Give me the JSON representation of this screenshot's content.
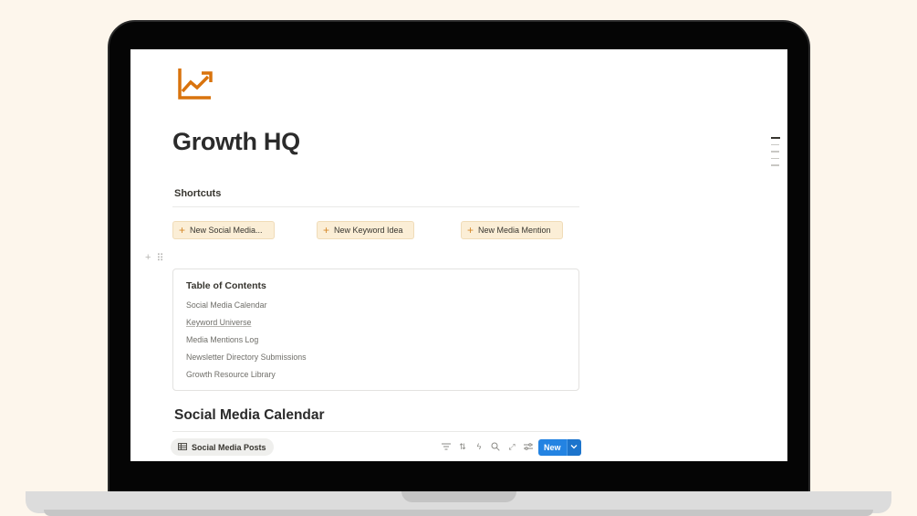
{
  "page": {
    "title": "Growth HQ",
    "icon": "trending-up-chart-icon",
    "accent_color": "#d9730d"
  },
  "shortcuts": {
    "heading": "Shortcuts",
    "buttons": [
      {
        "label": "New Social Media..."
      },
      {
        "label": "New Keyword Idea"
      },
      {
        "label": "New Media Mention"
      }
    ]
  },
  "toc": {
    "title": "Table of Contents",
    "items": [
      "Social Media Calendar",
      "Keyword Universe",
      "Media Mentions Log",
      "Newsletter Directory Submissions",
      "Growth Resource Library"
    ]
  },
  "database": {
    "heading": "Social Media Calendar",
    "view_tab": "Social Media Posts",
    "toolbar_icons": [
      "filter-icon",
      "sort-icon",
      "lightning-icon",
      "search-icon",
      "expand-icon",
      "settings-icon"
    ],
    "new_button": "New"
  },
  "colors": {
    "shortcut_bg": "#fbeed6",
    "new_button": "#2383e2"
  }
}
